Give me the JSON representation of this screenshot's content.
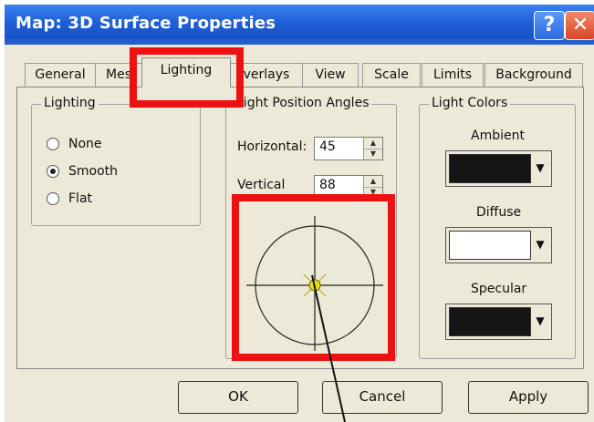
{
  "window": {
    "title": "Map: 3D Surface Properties",
    "help_glyph": "?",
    "close_glyph": "✕"
  },
  "tabs": [
    {
      "label": "General"
    },
    {
      "label": "Mes"
    },
    {
      "label": "Lighting",
      "active": true
    },
    {
      "label": "verlays"
    },
    {
      "label": "View"
    },
    {
      "label": "Scale"
    },
    {
      "label": "Limits"
    },
    {
      "label": "Background"
    }
  ],
  "lighting": {
    "group_label": "Lighting",
    "options": [
      {
        "label": "None",
        "selected": false
      },
      {
        "label": "Smooth",
        "selected": true
      },
      {
        "label": "Flat",
        "selected": false
      }
    ]
  },
  "position": {
    "group_label": "Light Position Angles",
    "horizontal_label": "Horizontal:",
    "horizontal_value": "45",
    "vertical_label": "Vertical",
    "vertical_value": "88"
  },
  "light_colors": {
    "group_label": "Light Colors",
    "ambient_label": "Ambient",
    "ambient_color": "#151515",
    "diffuse_label": "Diffuse",
    "diffuse_color": "#ffffff",
    "specular_label": "Specular",
    "specular_color": "#151515"
  },
  "buttons": {
    "ok": "OK",
    "cancel": "Cancel",
    "apply": "Apply"
  },
  "colors": {
    "highlight": "#ee1111",
    "light_dot": "#e8e010",
    "titlebar": "#1f5fd6"
  }
}
